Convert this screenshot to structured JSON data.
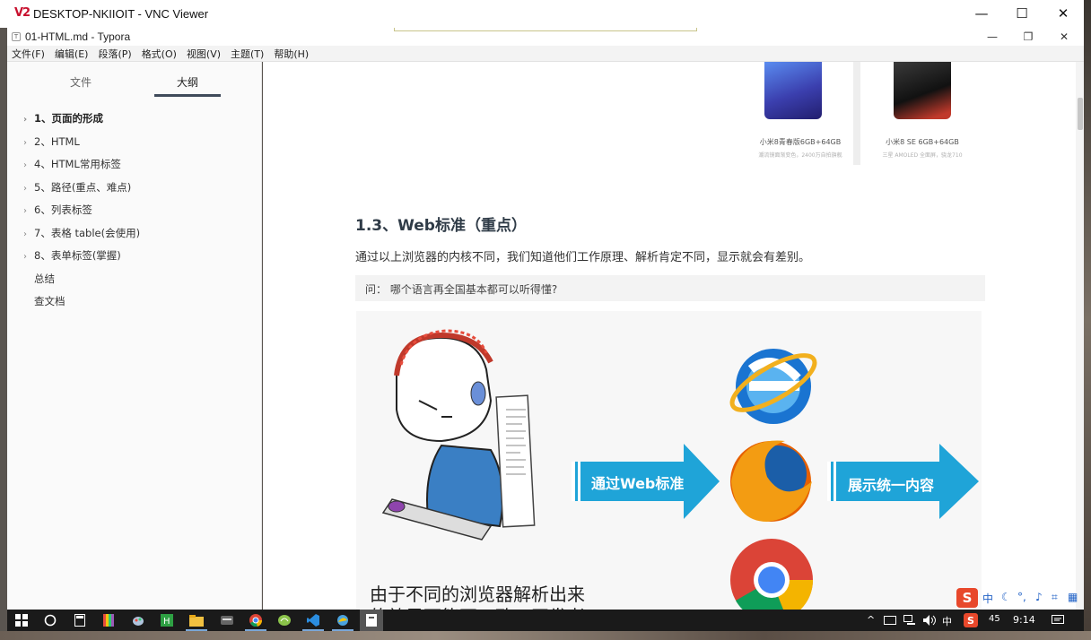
{
  "vnc": {
    "logo": "V2",
    "title": "DESKTOP-NKIIOIT - VNC Viewer",
    "minimize": "—",
    "maximize": "☐",
    "close": "✕"
  },
  "typora": {
    "icon": "T",
    "title": "01-HTML.md - Typora",
    "minimize": "—",
    "restore": "❐",
    "close": "✕"
  },
  "menubar": [
    "文件(F)",
    "编辑(E)",
    "段落(P)",
    "格式(O)",
    "视图(V)",
    "主题(T)",
    "帮助(H)"
  ],
  "sidebar": {
    "tabs": [
      "文件",
      "大纲"
    ],
    "active_tab": "大纲",
    "outline": [
      {
        "label": "1、页面的形成",
        "bold": true,
        "chevron": "›"
      },
      {
        "label": "2、HTML",
        "bold": false,
        "chevron": "›"
      },
      {
        "label": "4、HTML常用标签",
        "bold": false,
        "chevron": "›"
      },
      {
        "label": "5、路径(重点、难点)",
        "bold": false,
        "chevron": "›"
      },
      {
        "label": "6、列表标签",
        "bold": false,
        "chevron": "›"
      },
      {
        "label": "7、表格 table(会使用)",
        "bold": false,
        "chevron": "›"
      },
      {
        "label": "8、表单标签(掌握)",
        "bold": false,
        "chevron": "›"
      }
    ],
    "outline_plain": [
      "总结",
      "查文档"
    ],
    "footer_back": "‹",
    "footer_code": "</>"
  },
  "editor": {
    "products": [
      {
        "name": "小米8青春版6GB+64GB",
        "sub": "潮流镜面渐变色，2400万自拍旗舰",
        "color": "#3b3fae"
      },
      {
        "name": "小米8 SE 6GB+64GB",
        "sub": "三星 AMOLED 全面屏，骁龙710",
        "color": "#222222"
      }
    ],
    "heading": "1.3、Web标准（重点）",
    "paragraph": "通过以上浏览器的内核不同，我们知道他们工作原理、解析肯定不同，显示就会有差别。",
    "quote": "问：   哪个语言再全国基本都可以听得懂?",
    "illustration": {
      "arrow1": "通过Web标准",
      "arrow2": "展示统一内容",
      "caption": "由于不同的浏览器解析出来",
      "caption2": "的效果可能不一致，开发者"
    }
  },
  "taskbar": {
    "tray_caret": "^",
    "tray_lang": "中",
    "tray_volume": "45",
    "time": "9:14"
  },
  "ime": {
    "logo": "S",
    "mode": "中"
  }
}
